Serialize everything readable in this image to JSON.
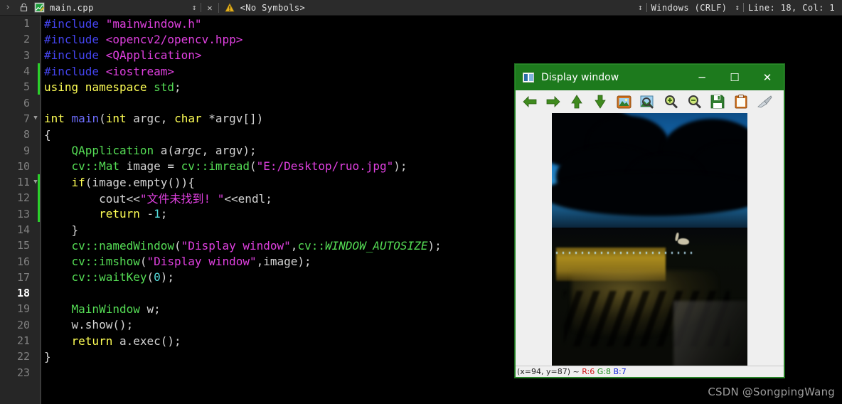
{
  "editor": {
    "chevron": "›",
    "lock_icon": "unlock-icon",
    "file_icon": "cpp-file-icon",
    "filename": "main.cpp",
    "updown_glyph": "↕",
    "close_glyph": "✕",
    "warn_glyph": "⚠",
    "symbols_label": "<No Symbols>",
    "eol_mode": "Windows (CRLF)",
    "line_col": "Line: 18, Col: 1"
  },
  "code": {
    "current_line": 18,
    "lines": [
      {
        "n": 1,
        "fold": "",
        "mark": false,
        "cur": false
      },
      {
        "n": 2,
        "fold": "",
        "mark": false,
        "cur": false
      },
      {
        "n": 3,
        "fold": "",
        "mark": false,
        "cur": false
      },
      {
        "n": 4,
        "fold": "",
        "mark": true,
        "cur": false
      },
      {
        "n": 5,
        "fold": "",
        "mark": true,
        "cur": false
      },
      {
        "n": 6,
        "fold": "",
        "mark": false,
        "cur": false
      },
      {
        "n": 7,
        "fold": "▼",
        "mark": false,
        "cur": false
      },
      {
        "n": 8,
        "fold": "",
        "mark": false,
        "cur": false
      },
      {
        "n": 9,
        "fold": "",
        "mark": false,
        "cur": false
      },
      {
        "n": 10,
        "fold": "",
        "mark": false,
        "cur": false
      },
      {
        "n": 11,
        "fold": "▼",
        "mark": true,
        "cur": false
      },
      {
        "n": 12,
        "fold": "",
        "mark": true,
        "cur": false
      },
      {
        "n": 13,
        "fold": "",
        "mark": true,
        "cur": false
      },
      {
        "n": 14,
        "fold": "",
        "mark": false,
        "cur": false
      },
      {
        "n": 15,
        "fold": "",
        "mark": false,
        "cur": false
      },
      {
        "n": 16,
        "fold": "",
        "mark": false,
        "cur": false
      },
      {
        "n": 17,
        "fold": "",
        "mark": false,
        "cur": false
      },
      {
        "n": 18,
        "fold": "",
        "mark": false,
        "cur": true
      },
      {
        "n": 19,
        "fold": "",
        "mark": false,
        "cur": false
      },
      {
        "n": 20,
        "fold": "",
        "mark": false,
        "cur": false
      },
      {
        "n": 21,
        "fold": "",
        "mark": false,
        "cur": false
      },
      {
        "n": 22,
        "fold": "",
        "mark": false,
        "cur": false
      },
      {
        "n": 23,
        "fold": "",
        "mark": false,
        "cur": false
      }
    ],
    "text": [
      "#include \"mainwindow.h\"",
      "#include <opencv2/opencv.hpp>",
      "#include <QApplication>",
      "#include <iostream>",
      "using namespace std;",
      "",
      "int main(int argc, char *argv[])",
      "{",
      "    QApplication a(argc, argv);",
      "    cv::Mat image = cv::imread(\"E:/Desktop/ruo.jpg\");",
      "    if(image.empty()){",
      "        cout<<\"文件未找到! \"<<endl;",
      "        return -1;",
      "    }",
      "    cv::namedWindow(\"Display window\",cv::WINDOW_AUTOSIZE);",
      "    cv::imshow(\"Display window\",image);",
      "    cv::waitKey(0);",
      "",
      "    MainWindow w;",
      "    w.show();",
      "    return a.exec();",
      "}",
      ""
    ]
  },
  "display_window": {
    "title": "Display window",
    "minimize_glyph": "─",
    "maximize_glyph": "☐",
    "close_glyph": "✕",
    "toolbar_icons": [
      "arrow-left-icon",
      "arrow-right-icon",
      "arrow-up-icon",
      "arrow-down-icon",
      "fit-image-icon",
      "zoom-fit-icon",
      "zoom-in-icon",
      "zoom-out-icon",
      "save-icon",
      "copy-icon",
      "brush-icon"
    ],
    "status": {
      "coords": "(x=94, y=87) ~ ",
      "r": "R:6",
      "g": " G:8",
      "b": " B:7"
    }
  },
  "watermark": "CSDN @SongpingWang",
  "colors": {
    "titlebar_green": "#1d7a1d",
    "gutter": "#262626",
    "editor_bg": "#000000",
    "change_marker": "#2bd02b"
  }
}
